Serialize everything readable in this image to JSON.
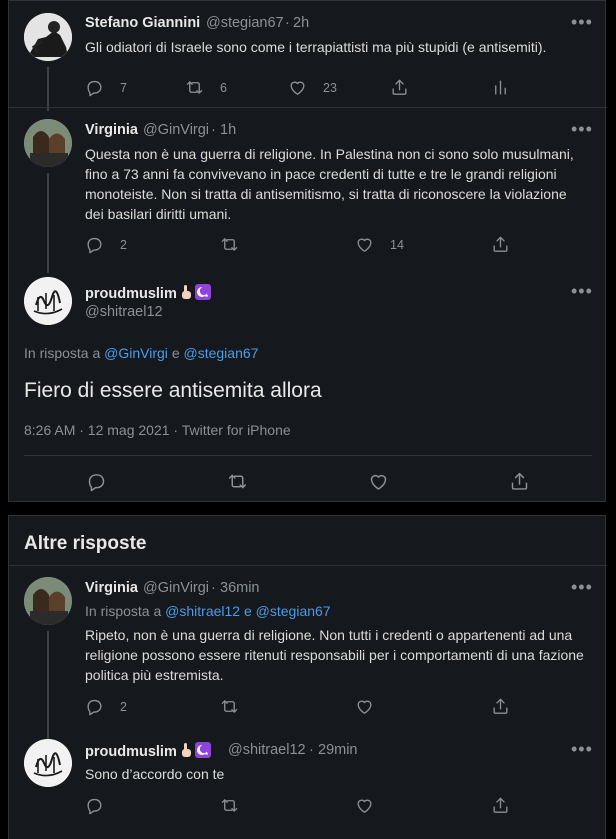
{
  "tweets": [
    {
      "name": "Stefano Giannini",
      "handle": "@stegian67",
      "time": "2h",
      "text": "Gli odiatori di Israele sono come i terrapiattisti ma più stupidi (e antisemiti).",
      "replies": "7",
      "retweets": "6",
      "likes": "23"
    },
    {
      "name": "Virginia",
      "handle": "@GinVirgi",
      "time": "1h",
      "text": "Questa non è una guerra di religione. In Palestina non ci sono solo musulmani, fino a 73 anni fa convivevano in pace credenti di tutte e tre le grandi religioni monoteiste. Non si tratta di antisemitismo, si tratta di riconoscere la violazione dei basilari diritti umani.",
      "replies": "2",
      "retweets": "",
      "likes": "14"
    }
  ],
  "main_tweet": {
    "name": "proudmuslim",
    "handle": "@shitrael12",
    "reply_prefix": "In risposta a",
    "reply_user1": "@GinVirgi",
    "reply_and": "e",
    "reply_user2": "@stegian67",
    "text": "Fiero di essere antisemita allora",
    "timestamp": "8:26 AM · 12 mag 2021 · Twitter for iPhone"
  },
  "more_replies_title": "Altre risposte",
  "replies": [
    {
      "name": "Virginia",
      "handle": "@GinVirgi",
      "time": "36min",
      "reply_prefix": "In risposta a",
      "reply_user1": "@shitrael12",
      "reply_and": "e",
      "reply_user2": "@stegian67",
      "text": "Ripeto, non è una guerra di religione. Non tutti i credenti o appartenenti ad una religione possono essere ritenuti responsabili per i comportamenti di una fazione politica più estremista.",
      "replies": "2"
    },
    {
      "name": "proudmuslim",
      "handle": "@shitrael12",
      "time": "29min",
      "text": "Sono d’accordo con te"
    }
  ],
  "ui": {
    "separator": "·",
    "more_dots": "•••"
  },
  "icons": [
    "reply-icon",
    "retweet-icon",
    "like-icon",
    "share-icon",
    "analytics-icon",
    "more-icon",
    "hand-emoji",
    "crescent-emoji"
  ]
}
